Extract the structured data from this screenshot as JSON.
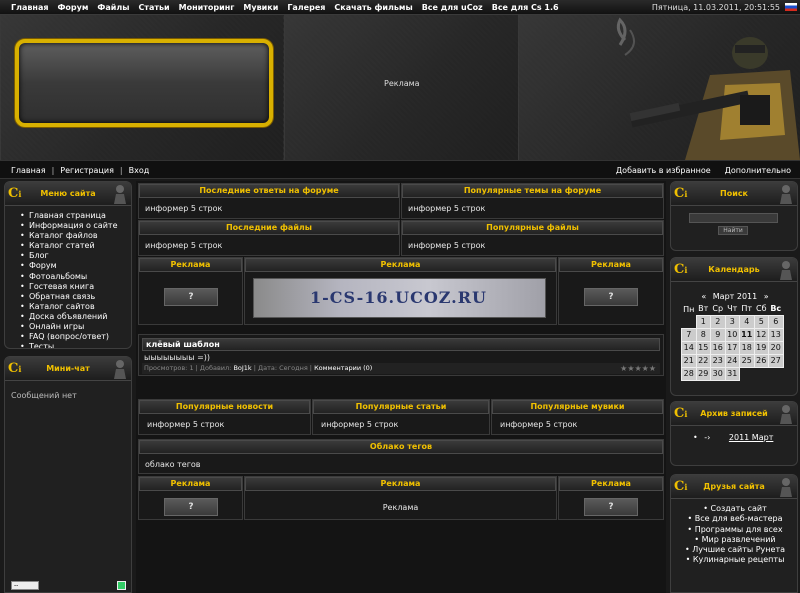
{
  "topbar": {
    "nav": [
      "Главная",
      "Форум",
      "Файлы",
      "Статьи",
      "Мониторинг",
      "Мувики",
      "Галерея",
      "Скачать фильмы",
      "Все для uCoz",
      "Все для Cs 1.6"
    ],
    "datetime": "Пятница, 11.03.2011, 20:51:55"
  },
  "header": {
    "ad_label": "Реклама"
  },
  "navbar2": {
    "home": "Главная",
    "register": "Регистрация",
    "login": "Вход",
    "separator": "|",
    "favorites": "Добавить в избранное",
    "more": "Дополнительно"
  },
  "left": {
    "menu": {
      "title": "Меню сайта",
      "items": [
        "Главная страница",
        "Информация о сайте",
        "Каталог файлов",
        "Каталог статей",
        "Блог",
        "Форум",
        "Фотоальбомы",
        "Гостевая книга",
        "Обратная связь",
        "Каталог сайтов",
        "Доска объявлений",
        "Онлайн игры",
        "FAQ (вопрос/ответ)",
        "Тесты"
      ]
    },
    "minichat": {
      "title": "Мини-чат",
      "empty_text": "Сообщений нет",
      "select_value": "--"
    }
  },
  "center": {
    "forum_answers": {
      "title": "Последние ответы на форуме",
      "body": "информер 5 строк"
    },
    "forum_topics": {
      "title": "Популярные темы на форуме",
      "body": "информер 5 строк"
    },
    "last_files": {
      "title": "Последние файлы",
      "body": "информер 5 строк"
    },
    "popular_files": {
      "title": "Популярные файлы",
      "body": "информер 5 строк"
    },
    "ads1": {
      "left": "Реклама",
      "mid": "Реклама",
      "right": "Реклама",
      "banner_text": "1-CS-16.UCOZ.RU",
      "btn": "?"
    },
    "post": {
      "title": "клёвый шаблон",
      "body": "ыыыыыыыы =))",
      "views_label": "Просмотров:",
      "views": "1",
      "added_label": "Добавил:",
      "author": "BoJ1k",
      "date_label": "Дата:",
      "date": "Сегодня",
      "comments": "Комментарии (0)"
    },
    "popular_news": {
      "title": "Популярные новости",
      "body": "информер 5 строк"
    },
    "popular_articles": {
      "title": "Популярные статьи",
      "body": "информер 5 строк"
    },
    "popular_movies": {
      "title": "Популярные мувики",
      "body": "информер 5 строк"
    },
    "tags": {
      "title": "Облако тегов",
      "body": "облако тегов"
    },
    "ads2": {
      "left": "Реклама",
      "mid": "Реклама",
      "right": "Реклама",
      "mid_body": "Реклама",
      "btn": "?"
    }
  },
  "right": {
    "search": {
      "title": "Поиск",
      "button": "Найти"
    },
    "calendar": {
      "title": "Календарь",
      "prev": "«",
      "next": "»",
      "month": "Март 2011",
      "weekdays": [
        "Пн",
        "Вт",
        "Ср",
        "Чт",
        "Пт",
        "Сб",
        "Вс"
      ],
      "weeks": [
        [
          "",
          "1",
          "2",
          "3",
          "4",
          "5",
          "6"
        ],
        [
          "7",
          "8",
          "9",
          "10",
          "11",
          "12",
          "13"
        ],
        [
          "14",
          "15",
          "16",
          "17",
          "18",
          "19",
          "20"
        ],
        [
          "21",
          "22",
          "23",
          "24",
          "25",
          "26",
          "27"
        ],
        [
          "28",
          "29",
          "30",
          "31",
          "",
          "",
          ""
        ]
      ],
      "today": "11"
    },
    "archive": {
      "title": "Архив записей",
      "item": "2011 Март"
    },
    "friends": {
      "title": "Друзья сайта",
      "items": [
        "Создать сайт",
        "Все для веб-мастера",
        "Программы для всех",
        "Мир развлечений",
        "Лучшие сайты Рунета",
        "Кулинарные рецепты"
      ]
    }
  }
}
